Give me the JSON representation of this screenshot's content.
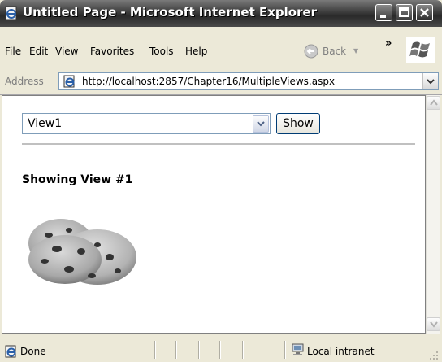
{
  "window": {
    "title": "Untitled Page - Microsoft Internet Explorer"
  },
  "menu": {
    "file": "File",
    "edit": "Edit",
    "view": "View",
    "favorites": "Favorites",
    "tools": "Tools",
    "help": "Help"
  },
  "toolbar": {
    "back_label": "Back",
    "overflow": "»"
  },
  "address": {
    "label": "Address",
    "url": "http://localhost:2857/Chapter16/MultipleViews.aspx"
  },
  "page": {
    "selected_view": "View1",
    "show_button": "Show",
    "heading": "Showing View #1"
  },
  "status": {
    "text": "Done",
    "zone": "Local intranet"
  },
  "icons": {
    "app": "ie-page-icon",
    "back": "back-arrow-icon",
    "address": "ie-page-icon",
    "zone": "local-intranet-icon"
  }
}
